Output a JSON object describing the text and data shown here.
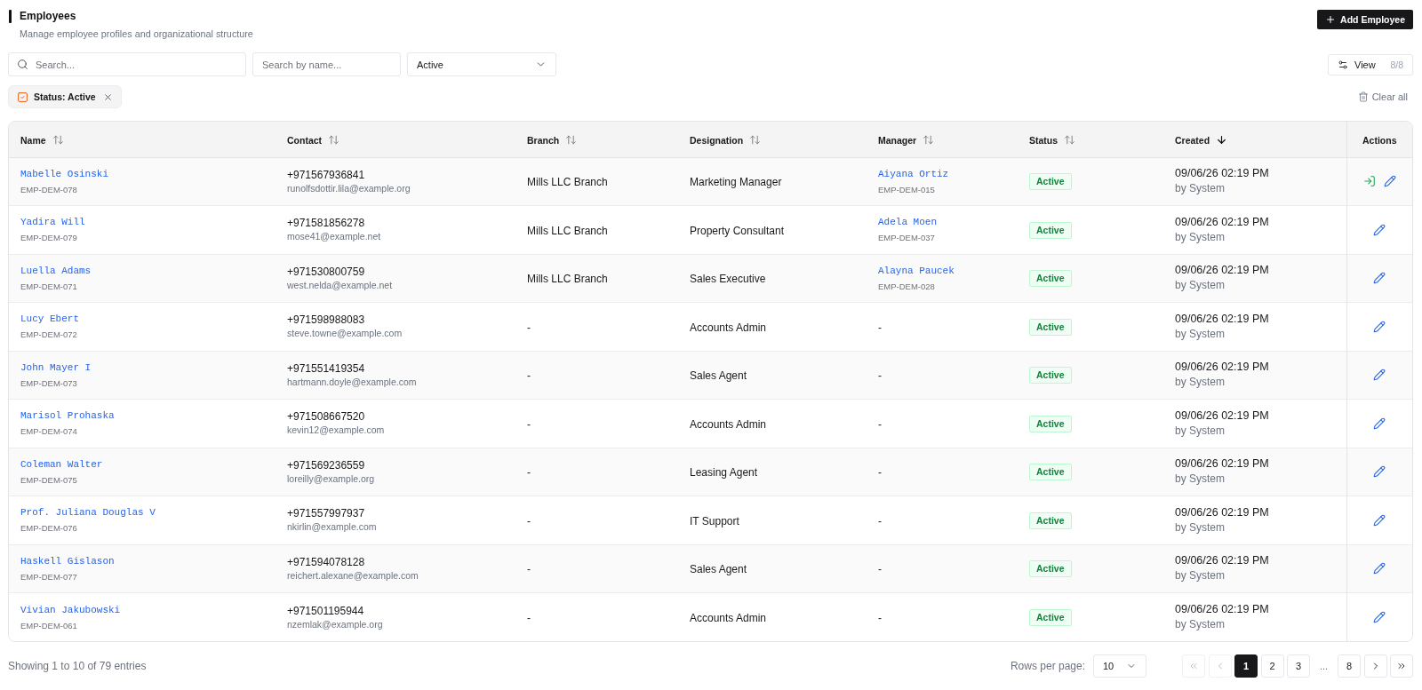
{
  "header": {
    "title": "Employees",
    "subtitle": "Manage employee profiles and organizational structure",
    "add_button": "Add Employee"
  },
  "filters": {
    "search": {
      "placeholder": "Search..."
    },
    "name_search": {
      "placeholder": "Search by name..."
    },
    "status_select": {
      "value": "Active"
    },
    "view_button": {
      "label": "View",
      "count": "8/8"
    }
  },
  "active_filters": {
    "chips": [
      {
        "label": "Status: Active"
      }
    ],
    "clear_all": "Clear all"
  },
  "table": {
    "columns": [
      {
        "label": "Name",
        "sortable": true,
        "sorted": false
      },
      {
        "label": "Contact",
        "sortable": true,
        "sorted": false
      },
      {
        "label": "Branch",
        "sortable": true,
        "sorted": false
      },
      {
        "label": "Designation",
        "sortable": true,
        "sorted": false
      },
      {
        "label": "Manager",
        "sortable": true,
        "sorted": false
      },
      {
        "label": "Status",
        "sortable": true,
        "sorted": false
      },
      {
        "label": "Created",
        "sortable": true,
        "sorted": true
      },
      {
        "label": "Actions",
        "sortable": false
      }
    ],
    "rows": [
      {
        "name": "Mabelle Osinski",
        "employee_id": "EMP-DEM-078",
        "phone": "+971567936841",
        "email": "runolfsdottir.lila@example.org",
        "branch": "Mills LLC Branch",
        "designation": "Marketing Manager",
        "manager": {
          "kind": "link",
          "name": "Aiyana Ortiz",
          "employee_id": "EMP-DEM-015"
        },
        "status": "Active",
        "created_at": "09/06/26 02:19 PM",
        "created_by": "by System",
        "actions": [
          {
            "kind": "login"
          },
          {
            "kind": "edit"
          }
        ]
      },
      {
        "name": "Yadira Will",
        "employee_id": "EMP-DEM-079",
        "phone": "+971581856278",
        "email": "mose41@example.net",
        "branch": "Mills LLC Branch",
        "designation": "Property Consultant",
        "manager": {
          "kind": "link",
          "name": "Adela Moen",
          "employee_id": "EMP-DEM-037"
        },
        "status": "Active",
        "created_at": "09/06/26 02:19 PM",
        "created_by": "by System",
        "actions": [
          {
            "kind": "edit"
          }
        ]
      },
      {
        "name": "Luella Adams",
        "employee_id": "EMP-DEM-071",
        "phone": "+971530800759",
        "email": "west.nelda@example.net",
        "branch": "Mills LLC Branch",
        "designation": "Sales Executive",
        "manager": {
          "kind": "link",
          "name": "Alayna Paucek",
          "employee_id": "EMP-DEM-028"
        },
        "status": "Active",
        "created_at": "09/06/26 02:19 PM",
        "created_by": "by System",
        "actions": [
          {
            "kind": "edit"
          }
        ]
      },
      {
        "name": "Lucy Ebert",
        "employee_id": "EMP-DEM-072",
        "phone": "+971598988083",
        "email": "steve.towne@example.com",
        "branch": "-",
        "designation": "Accounts Admin",
        "manager": {
          "kind": "empty",
          "text": "-"
        },
        "status": "Active",
        "created_at": "09/06/26 02:19 PM",
        "created_by": "by System",
        "actions": [
          {
            "kind": "edit"
          }
        ]
      },
      {
        "name": "John Mayer I",
        "employee_id": "EMP-DEM-073",
        "phone": "+971551419354",
        "email": "hartmann.doyle@example.com",
        "branch": "-",
        "designation": "Sales Agent",
        "manager": {
          "kind": "empty",
          "text": "-"
        },
        "status": "Active",
        "created_at": "09/06/26 02:19 PM",
        "created_by": "by System",
        "actions": [
          {
            "kind": "edit"
          }
        ]
      },
      {
        "name": "Marisol Prohaska",
        "employee_id": "EMP-DEM-074",
        "phone": "+971508667520",
        "email": "kevin12@example.com",
        "branch": "-",
        "designation": "Accounts Admin",
        "manager": {
          "kind": "empty",
          "text": "-"
        },
        "status": "Active",
        "created_at": "09/06/26 02:19 PM",
        "created_by": "by System",
        "actions": [
          {
            "kind": "edit"
          }
        ]
      },
      {
        "name": "Coleman Walter",
        "employee_id": "EMP-DEM-075",
        "phone": "+971569236559",
        "email": "loreilly@example.org",
        "branch": "-",
        "designation": "Leasing Agent",
        "manager": {
          "kind": "empty",
          "text": "-"
        },
        "status": "Active",
        "created_at": "09/06/26 02:19 PM",
        "created_by": "by System",
        "actions": [
          {
            "kind": "edit"
          }
        ]
      },
      {
        "name": "Prof. Juliana Douglas V",
        "employee_id": "EMP-DEM-076",
        "phone": "+971557997937",
        "email": "nkirlin@example.com",
        "branch": "-",
        "designation": "IT Support",
        "manager": {
          "kind": "empty",
          "text": "-"
        },
        "status": "Active",
        "created_at": "09/06/26 02:19 PM",
        "created_by": "by System",
        "actions": [
          {
            "kind": "edit"
          }
        ]
      },
      {
        "name": "Haskell Gislason",
        "employee_id": "EMP-DEM-077",
        "phone": "+971594078128",
        "email": "reichert.alexane@example.com",
        "branch": "-",
        "designation": "Sales Agent",
        "manager": {
          "kind": "empty",
          "text": "-"
        },
        "status": "Active",
        "created_at": "09/06/26 02:19 PM",
        "created_by": "by System",
        "actions": [
          {
            "kind": "edit"
          }
        ]
      },
      {
        "name": "Vivian Jakubowski",
        "employee_id": "EMP-DEM-061",
        "phone": "+971501195944",
        "email": "nzemlak@example.org",
        "branch": "-",
        "designation": "Accounts Admin",
        "manager": {
          "kind": "empty",
          "text": "-"
        },
        "status": "Active",
        "created_at": "09/06/26 02:19 PM",
        "created_by": "by System",
        "actions": [
          {
            "kind": "edit"
          }
        ]
      }
    ]
  },
  "footer": {
    "summary": "Showing 1 to 10 of 79 entries",
    "rows_per_page": {
      "label": "Rows per page:",
      "value": "10"
    },
    "pagination": [
      {
        "kind": "first",
        "disabled": true
      },
      {
        "kind": "prev",
        "disabled": true
      },
      {
        "kind": "page",
        "label": "1",
        "selected": true
      },
      {
        "kind": "page",
        "label": "2",
        "selected": false
      },
      {
        "kind": "page",
        "label": "3",
        "selected": false
      },
      {
        "kind": "ellipsis",
        "label": "..."
      },
      {
        "kind": "page",
        "label": "8",
        "selected": false
      },
      {
        "kind": "next",
        "disabled": false
      },
      {
        "kind": "last",
        "disabled": false
      }
    ]
  }
}
